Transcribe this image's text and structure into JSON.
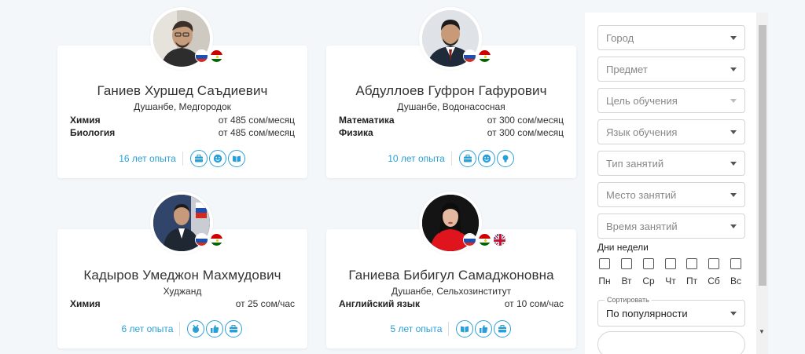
{
  "tutors": [
    {
      "name": "Ганиев Хуршед Саъдиевич",
      "location": "Душанбе, Медгородок",
      "subjects": [
        {
          "name": "Химия",
          "price": "от  485 сом/месяц"
        },
        {
          "name": "Биология",
          "price": "от  485 сом/месяц"
        }
      ],
      "experience": "16 лет опыта",
      "flags": [
        "russia-flag-icon",
        "tajikistan-flag-icon"
      ],
      "badges": [
        "briefcase-icon",
        "smile-icon",
        "book-icon"
      ]
    },
    {
      "name": "Абдуллоев Гуфрон Гафурович",
      "location": "Душанбе, Водонасосная",
      "subjects": [
        {
          "name": "Математика",
          "price": "от  300 сом/месяц"
        },
        {
          "name": "Физика",
          "price": "от  300 сом/месяц"
        }
      ],
      "experience": "10 лет опыта",
      "flags": [
        "russia-flag-icon",
        "tajikistan-flag-icon"
      ],
      "badges": [
        "briefcase-icon",
        "smile-icon",
        "lightbulb-icon"
      ]
    },
    {
      "name": "Кадыров Умеджон Махмудович",
      "location": "Худжанд",
      "subjects": [
        {
          "name": "Химия",
          "price": "от  25 сом/час"
        }
      ],
      "experience": "6 лет опыта",
      "flags": [
        "russia-flag-icon",
        "tajikistan-flag-icon"
      ],
      "badges": [
        "medal-icon",
        "thumbs-up-icon",
        "briefcase-icon"
      ]
    },
    {
      "name": "Ганиева Бибигул Самаджоновна",
      "location": "Душанбе, Сельхозинститут",
      "subjects": [
        {
          "name": "Английский язык",
          "price": "от  10 сом/час"
        }
      ],
      "experience": "5 лет опыта",
      "flags": [
        "russia-flag-icon",
        "tajikistan-flag-icon",
        "uk-flag-icon"
      ],
      "badges": [
        "book-icon",
        "thumbs-up-icon",
        "briefcase-icon"
      ]
    }
  ],
  "filters": {
    "city": "Город",
    "subject": "Предмет",
    "goal": "Цель обучения",
    "language": "Язык обучения",
    "lesson_type": "Тип занятий",
    "place": "Место занятий",
    "time": "Время занятий",
    "days_label": "Дни недели",
    "days": [
      "Пн",
      "Вт",
      "Ср",
      "Чт",
      "Пт",
      "Сб",
      "Вс"
    ],
    "sort_label": "Сортировать",
    "sort_value": "По популярности"
  },
  "colors": {
    "accent": "#2a9fd6",
    "background": "#f3f7fa"
  }
}
